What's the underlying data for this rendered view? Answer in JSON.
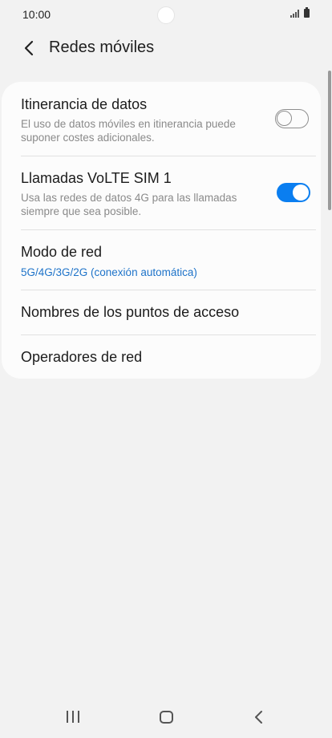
{
  "status_bar": {
    "time": "10:00",
    "icons": [
      "signal-icon",
      "battery-icon"
    ]
  },
  "header": {
    "title": "Redes móviles",
    "back_icon": "chevron-left-icon"
  },
  "settings": [
    {
      "title": "Itinerancia de datos",
      "subtitle": "El uso de datos móviles en itinerancia puede suponer costes adicionales.",
      "toggle": false
    },
    {
      "title": "Llamadas VoLTE SIM 1",
      "subtitle": "Usa las redes de datos 4G para las llamadas siempre que sea posible.",
      "toggle": true
    },
    {
      "title": "Modo de red",
      "subtitle": "5G/4G/3G/2G (conexión automática)"
    },
    {
      "title": "Nombres de los puntos de acceso"
    },
    {
      "title": "Operadores de red"
    }
  ],
  "colors": {
    "accent": "#0a7ef0",
    "link": "#1e73c9",
    "background": "#f2f2f2",
    "card": "#fcfcfc"
  },
  "nav_bar": {
    "icons": [
      "recents-icon",
      "home-icon",
      "back-icon"
    ]
  }
}
